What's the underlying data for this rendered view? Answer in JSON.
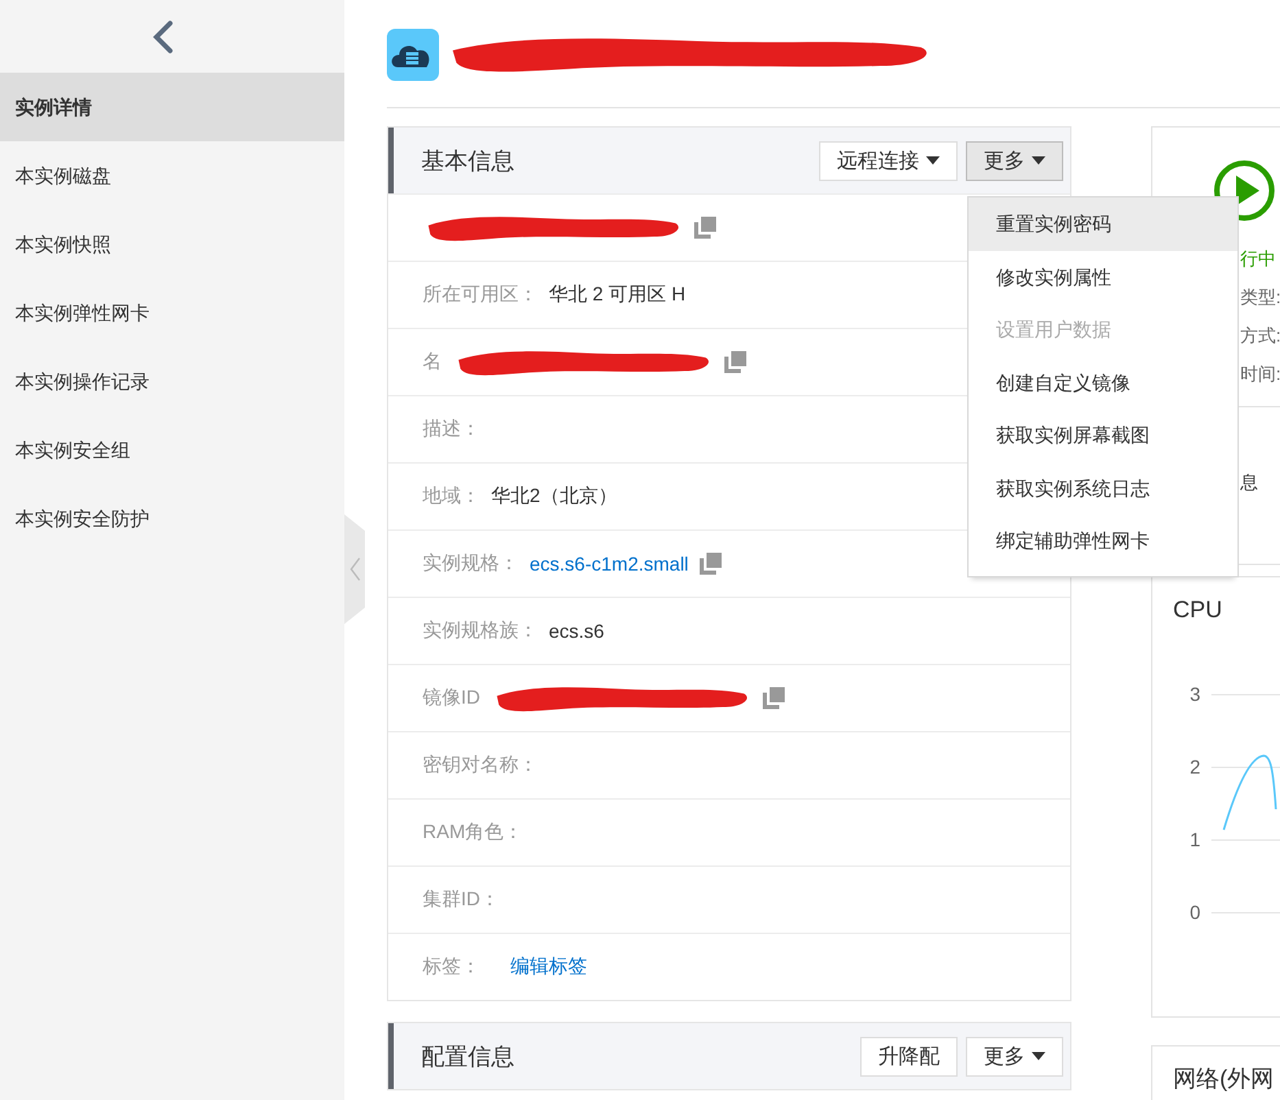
{
  "sidebar": {
    "items": [
      {
        "label": "实例详情",
        "selected": true
      },
      {
        "label": "本实例磁盘",
        "selected": false
      },
      {
        "label": "本实例快照",
        "selected": false
      },
      {
        "label": "本实例弹性网卡",
        "selected": false
      },
      {
        "label": "本实例操作记录",
        "selected": false
      },
      {
        "label": "本实例安全组",
        "selected": false
      },
      {
        "label": "本实例安全防护",
        "selected": false
      }
    ]
  },
  "header": {
    "title_redacted": true
  },
  "basic_info": {
    "title": "基本信息",
    "buttons": [
      {
        "label": "远程连接",
        "caret": true,
        "pressed": false
      },
      {
        "label": "更多",
        "caret": true,
        "pressed": true
      }
    ],
    "rows": [
      {
        "redacted": true,
        "copy_icon": true
      },
      {
        "label": "所在可用区：",
        "value": "华北 2 可用区 H",
        "kind": "text"
      },
      {
        "label": "名",
        "redacted": true,
        "copy_icon": true
      },
      {
        "label": "描述："
      },
      {
        "label": "地域：",
        "value": "华北2（北京）",
        "kind": "text"
      },
      {
        "label": "实例规格：",
        "value": "ecs.s6-c1m2.small",
        "kind": "link",
        "copy_icon": true
      },
      {
        "label": "实例规格族：",
        "value": "ecs.s6",
        "kind": "text"
      },
      {
        "label": "镜像ID",
        "redacted": true,
        "copy_icon": true
      },
      {
        "label": "密钥对名称："
      },
      {
        "label": "RAM角色："
      },
      {
        "label": "集群ID："
      },
      {
        "label": "标签：",
        "value": "编辑标签",
        "kind": "link"
      }
    ]
  },
  "more_menu": {
    "items": [
      {
        "label": "重置实例密码",
        "highlighted": true,
        "disabled": false
      },
      {
        "label": "修改实例属性",
        "highlighted": false,
        "disabled": false
      },
      {
        "label": "设置用户数据",
        "highlighted": false,
        "disabled": true
      },
      {
        "label": "创建自定义镜像",
        "highlighted": false,
        "disabled": false
      },
      {
        "label": "获取实例屏幕截图",
        "highlighted": false,
        "disabled": false
      },
      {
        "label": "获取实例系统日志",
        "highlighted": false,
        "disabled": false
      },
      {
        "label": "绑定辅助弹性网卡",
        "highlighted": false,
        "disabled": false
      }
    ]
  },
  "config_info": {
    "title": "配置信息",
    "buttons": [
      {
        "label": "升降配",
        "caret": false,
        "pressed": false
      },
      {
        "label": "更多",
        "caret": true,
        "pressed": false
      }
    ]
  },
  "status_card": {
    "status": "行中",
    "fields": [
      "类型:",
      "方式:",
      "时间:"
    ],
    "section_fragment": "息"
  },
  "cpu_card": {
    "title": "CPU",
    "axis_labels": [
      "3",
      "2",
      "1",
      "0"
    ]
  },
  "network_card": {
    "title": "网络(外网"
  }
}
